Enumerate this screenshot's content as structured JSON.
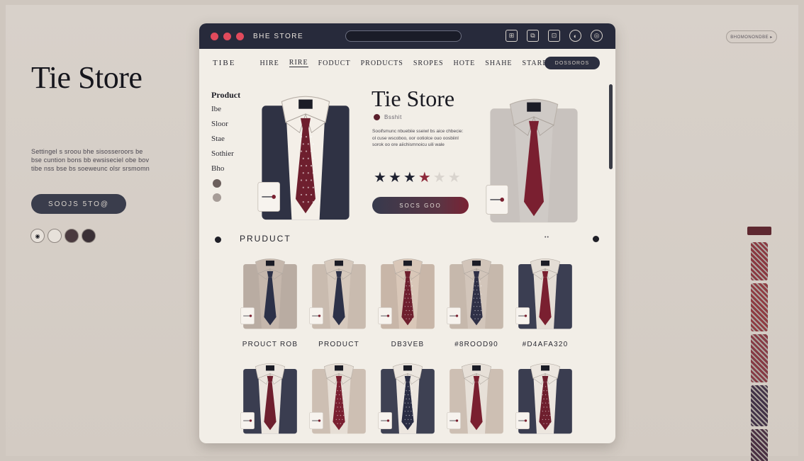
{
  "colors": {
    "navy": "#272a3b",
    "burgundy": "#6e1f2e",
    "cream": "#f2eee7",
    "background": "#cfc7bf",
    "traffic_lights": [
      "#e14a5c",
      "#e14a5c",
      "#e14a5c"
    ]
  },
  "hero": {
    "title": "Tie Store",
    "text": "Settingel s sroou bhe sisosseroors be bse cuntion bons bb ewsiseciel obe bov tibe nss bse bs soeweunc olsr srsmomn",
    "button_label": "SOOJS 5TO@",
    "dots": [
      {
        "icon": "eye-icon",
        "color": "#e7e1da"
      },
      {
        "icon": "circle-icon",
        "color": "#e7e1da"
      },
      {
        "icon": "circle-icon",
        "color": "#4a3a3f"
      },
      {
        "icon": "circle-icon",
        "color": "#3a3036"
      }
    ]
  },
  "top_right": {
    "label": "BHOMONONDBE ▸"
  },
  "window": {
    "title": "BHE STORE",
    "toolbar_icons": [
      "grid-icon",
      "copy-icon",
      "cart-icon",
      "profile-icon",
      "settings-icon"
    ],
    "toolbar_glyphs": [
      "⊞",
      "⧉",
      "⊡",
      "◐",
      "◎"
    ],
    "nav": {
      "brand": "TIBE",
      "items": [
        "HIRE",
        "RIRE",
        "FODUCT",
        "PRODUCTS",
        "SROPES",
        "HOTE",
        "SHAHE",
        "STARE-"
      ],
      "active_index": 1,
      "cta_label": "DOSSOROS"
    },
    "sidebar": {
      "heading": "Product",
      "items": [
        "Ibe",
        "Sloor",
        "Stae",
        "Sothier",
        "Bho"
      ],
      "icons": [
        {
          "name": "face-icon",
          "color": "#6b5f5c"
        },
        {
          "name": "face-icon",
          "color": "#a69c97"
        }
      ]
    },
    "product": {
      "title": "Tie Store",
      "subtitle": "Bsshit",
      "description": "Sooifsmunc nbuebiie sseiwl bs aice chbecie: ol cuse wscoboo, oor ootiolce ouo oosbiinl sorok oo ore aiichismnoicu uili wale",
      "rating": 3.5,
      "star_color_filled": "#1f2130",
      "star_color_accent": "#8e2a3b",
      "star_color_empty": "#d9d4ce",
      "buy_label": "SOCS GOO"
    },
    "section": {
      "title": "PRUDUCT",
      "more": "••"
    },
    "grid": {
      "labels": [
        "PROUCT ROB",
        "PRODUCT",
        "DB3VEB",
        "#8ROOD90",
        "#D4AFA320"
      ],
      "row1": [
        {
          "shirt": "#c5b7ac",
          "tie": "#2c3148",
          "jacket": "#b9aca2",
          "pattern": "solid"
        },
        {
          "shirt": "#d6c9bd",
          "tie": "#2c3148",
          "jacket": "#c9bbaf",
          "pattern": "solid"
        },
        {
          "shirt": "#d9c7b8",
          "tie": "#6e1f2e",
          "jacket": "#c8b6a8",
          "pattern": "dots"
        },
        {
          "shirt": "#d2c5ba",
          "tie": "#2f3047",
          "jacket": "#c6b8ac",
          "pattern": "dots"
        },
        {
          "shirt": "#e4ddd5",
          "tie": "#7a1f30",
          "jacket": "#3b3e52",
          "pattern": "solid"
        }
      ],
      "row2": [
        {
          "shirt": "#ece6df",
          "tie": "#6e1f2e",
          "jacket": "#3a3d50",
          "pattern": "solid"
        },
        {
          "shirt": "#e6ded5",
          "tie": "#7a1f30",
          "jacket": "#cdbfb3",
          "pattern": "dots"
        },
        {
          "shirt": "#ece6df",
          "tie": "#2a2d44",
          "jacket": "#3e4153",
          "pattern": "dots"
        },
        {
          "shirt": "#e7e0d8",
          "tie": "#7a1f30",
          "jacket": "#cdbfb3",
          "pattern": "solid"
        },
        {
          "shirt": "#ece6df",
          "tie": "#6e1f2e",
          "jacket": "#3a3d50",
          "pattern": "dots"
        }
      ]
    },
    "hero_shirts": [
      {
        "shirt": "#f4efe8",
        "tie": "#6e1f2e",
        "jacket": "#2f3244",
        "pattern": "dots"
      },
      {
        "shirt": "#cfcac6",
        "tie": "#7a1f30",
        "jacket": "#c8c2be",
        "pattern": "solid"
      }
    ]
  },
  "tie_strip": [
    {
      "color": "#8a3840"
    },
    {
      "color": "#8f3b42"
    },
    {
      "color": "#863a44"
    },
    {
      "color": "#423247"
    },
    {
      "color": "#4a2f42"
    }
  ]
}
